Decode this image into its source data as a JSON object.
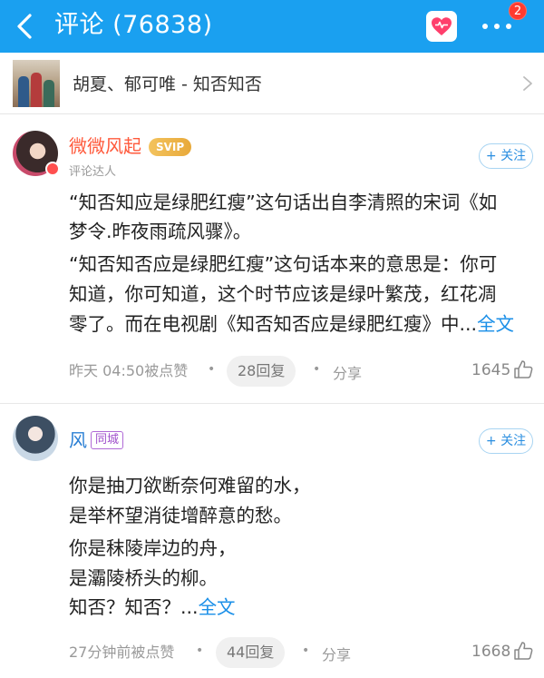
{
  "header": {
    "title": "评论 (76838)",
    "notification_count": "2"
  },
  "source": {
    "title": "胡夏、郁可唯 - 知否知否"
  },
  "comments": [
    {
      "username": "微微风起",
      "badge": "SVIP",
      "tag": "评论达人",
      "follow_label": "+ 关注",
      "lines": [
        "“知否知应是绿肥红瘦”这句话出自李清照的宋词《如",
        "梦令.昨夜雨疏风骤》。",
        "“知否知否应是绿肥红瘦”这句话本来的意思是：你可",
        "知道，你可知道，这个时节应该是绿叶繁茂，红花凋",
        "零了。而在电视剧《知否知否应是绿肥红瘦》中..."
      ],
      "more_label": "全文",
      "time": "昨天 04:50被点赞",
      "replies": "28回复",
      "share_label": "分享",
      "likes": "1645"
    },
    {
      "username": "风",
      "badge": "同城",
      "follow_label": "+ 关注",
      "lines": [
        "你是抽刀欲断奈何难留的水，",
        "是举杯望消徒增醉意的愁。",
        "你是秣陵岸边的舟，",
        "是灞陵桥头的柳。",
        "知否？知否？..."
      ],
      "more_label": "全文",
      "time": "27分钟前被点赞",
      "replies": "44回复",
      "share_label": "分享",
      "likes": "1668"
    }
  ],
  "icons": {
    "back": "back-arrow-icon",
    "heart": "heart-icon",
    "more": "more-dots-icon",
    "chevron": "chevron-right-icon",
    "like": "thumbs-up-icon"
  },
  "colors": {
    "header_bg": "#1aa0f0",
    "link": "#1a8fe8",
    "badge_red": "#ff3b30",
    "vip_gold": "#e8a93a"
  }
}
